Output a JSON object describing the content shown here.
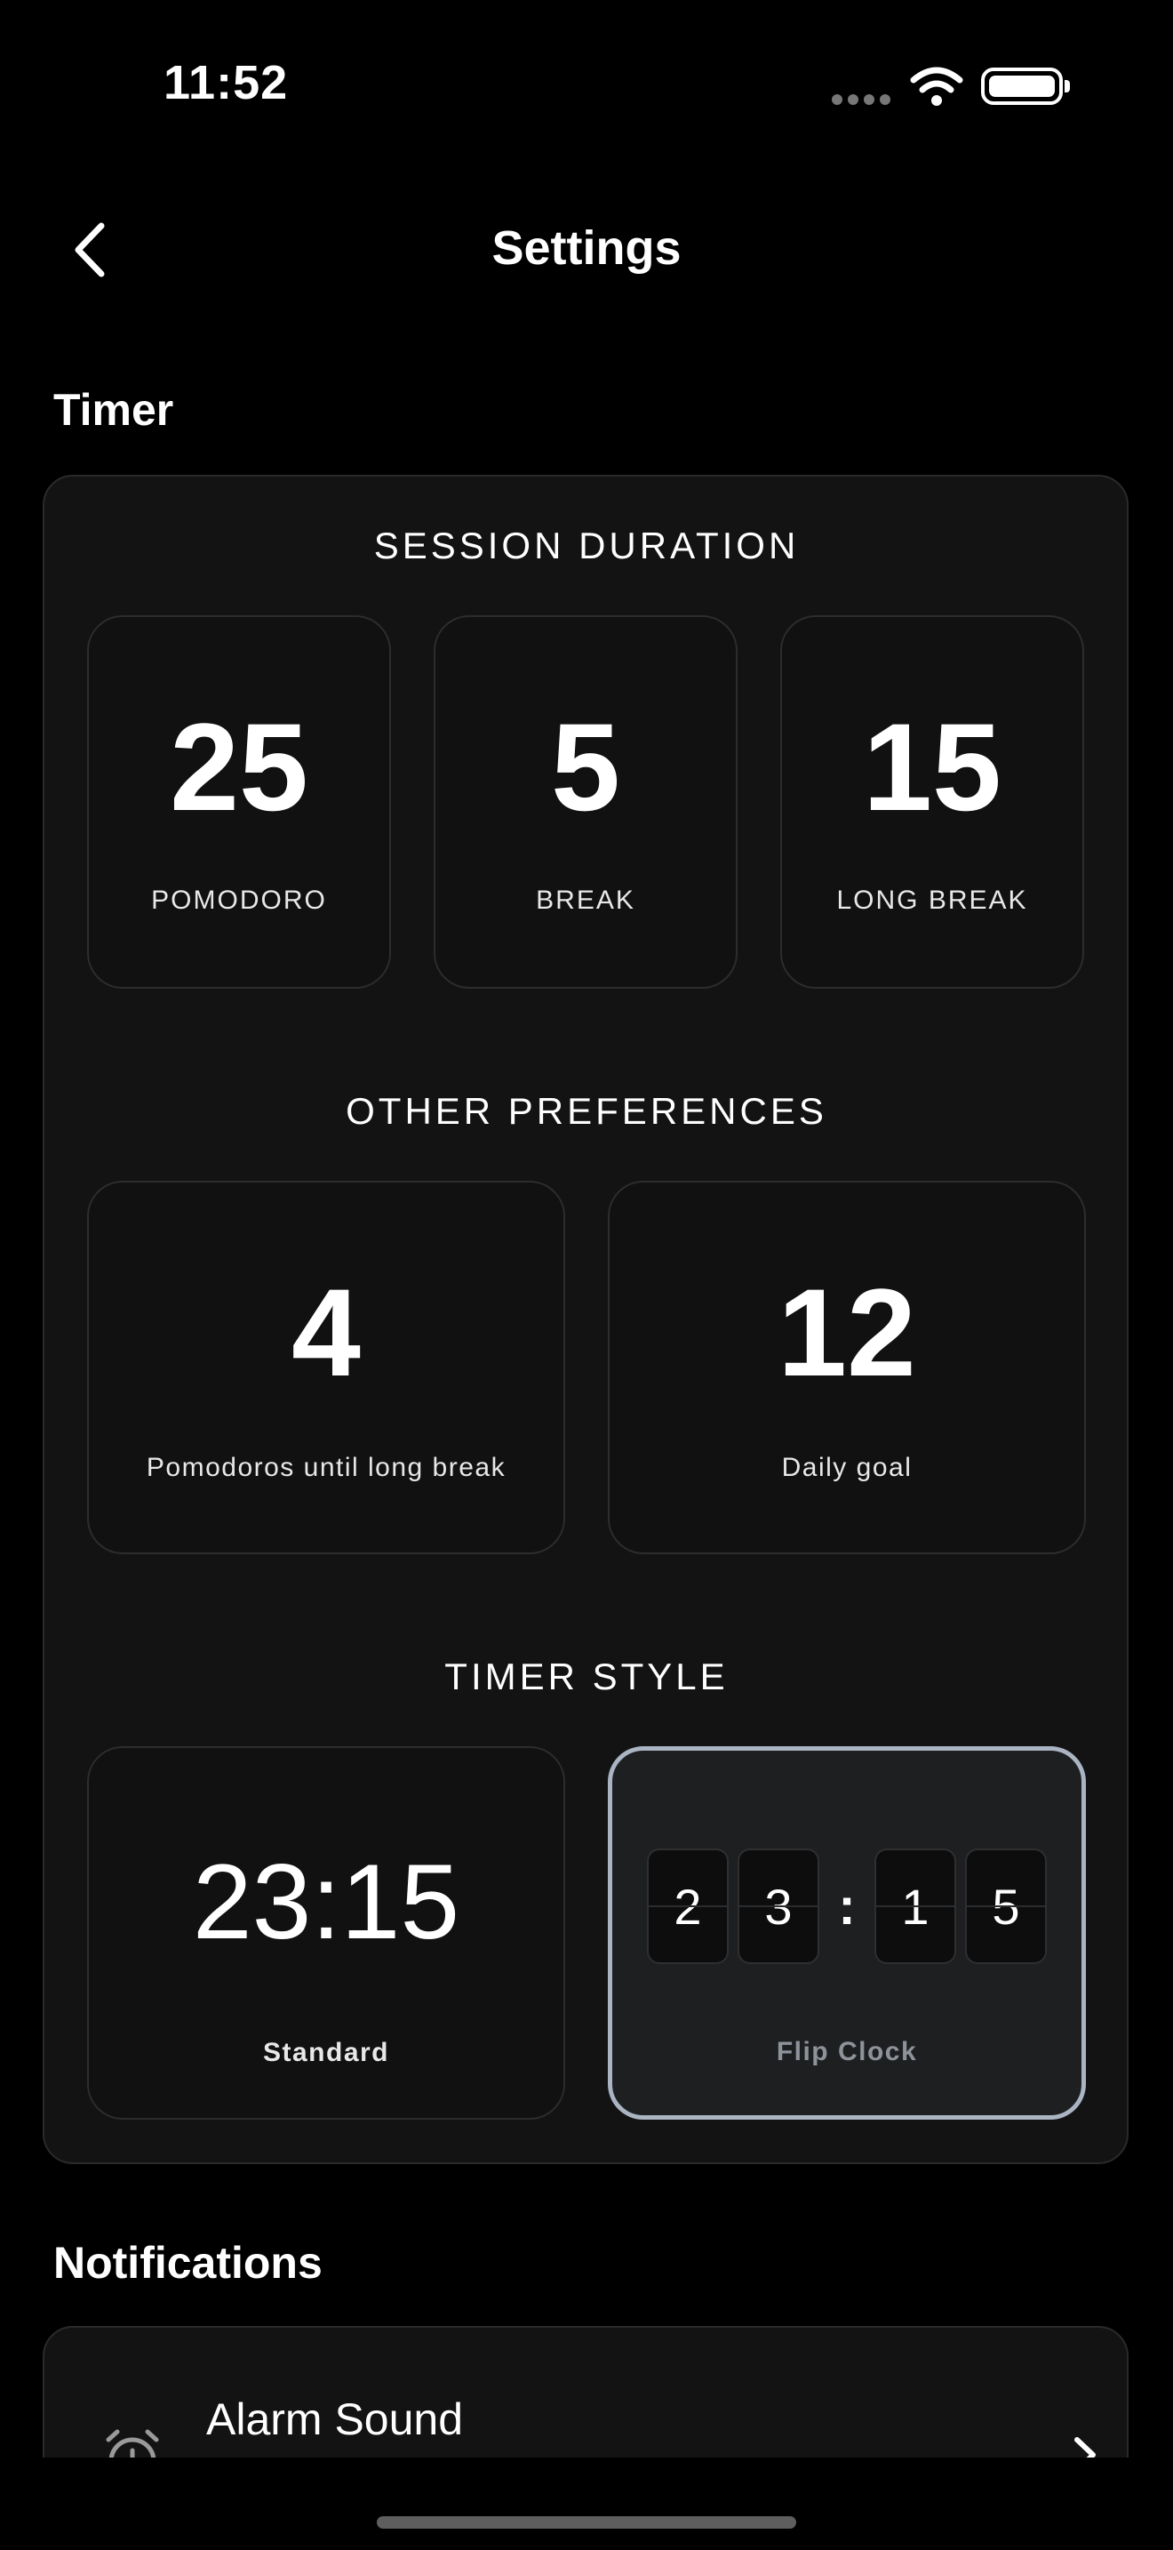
{
  "status_bar": {
    "time": "11:52"
  },
  "nav": {
    "title": "Settings"
  },
  "timer_section": {
    "heading": "Timer",
    "session_duration": {
      "title": "SESSION DURATION",
      "items": [
        {
          "value": "25",
          "label": "POMODORO"
        },
        {
          "value": "5",
          "label": "BREAK"
        },
        {
          "value": "15",
          "label": "LONG BREAK"
        }
      ]
    },
    "other_preferences": {
      "title": "OTHER PREFERENCES",
      "items": [
        {
          "value": "4",
          "label": "Pomodoros until long break"
        },
        {
          "value": "12",
          "label": "Daily goal"
        }
      ]
    },
    "timer_style": {
      "title": "TIMER STYLE",
      "standard": {
        "preview": "23:15",
        "label": "Standard"
      },
      "flip": {
        "digits": [
          "2",
          "3",
          "1",
          "5"
        ],
        "separator": ":",
        "label": "Flip Clock",
        "selected": true
      }
    }
  },
  "notifications_section": {
    "heading": "Notifications",
    "items": [
      {
        "label": "Alarm Sound",
        "icon": "alarm-clock-icon"
      }
    ]
  }
}
